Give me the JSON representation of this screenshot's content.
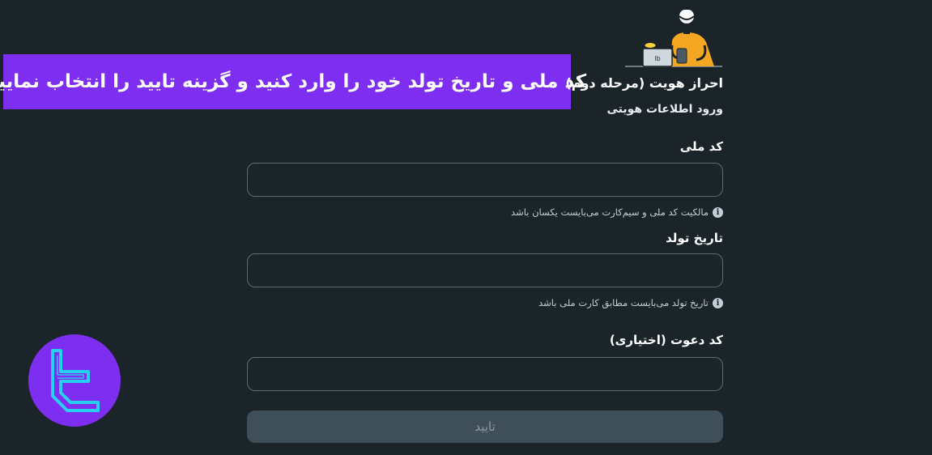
{
  "banner": {
    "text": "کد ملی و تاریخ تولد خود را وارد کنید و گزینه تایید را انتخاب نمایید",
    "color": "#7e2ef0"
  },
  "header": {
    "title": "احراز هویت (مرحله دوم)",
    "subtitle": "ورود اطلاعات هویتی"
  },
  "form": {
    "national_code": {
      "label": "کد ملی",
      "value": "",
      "hint": "مالکیت کد ملی و سیم‌کارت می‌بایست یکسان باشد"
    },
    "birth_date": {
      "label": "تاریخ تولد",
      "value": "",
      "hint": "تاریخ تولد می‌بایست مطابق کارت ملی باشد"
    },
    "referral_code": {
      "label": "کد دعوت (اختیاری)",
      "value": ""
    },
    "submit_label": "تایید"
  },
  "icons": {
    "info": "info-icon",
    "logo": "brand-logo-icon",
    "illustration": "person-at-laptop-illustration"
  },
  "colors": {
    "background": "#1b2429",
    "field_border": "#5a6b78",
    "button_bg": "#3f4f5a",
    "logo_bg": "#7e2ef0",
    "logo_stroke": "#26d0f0",
    "illustration_accent": "#f5a623"
  }
}
